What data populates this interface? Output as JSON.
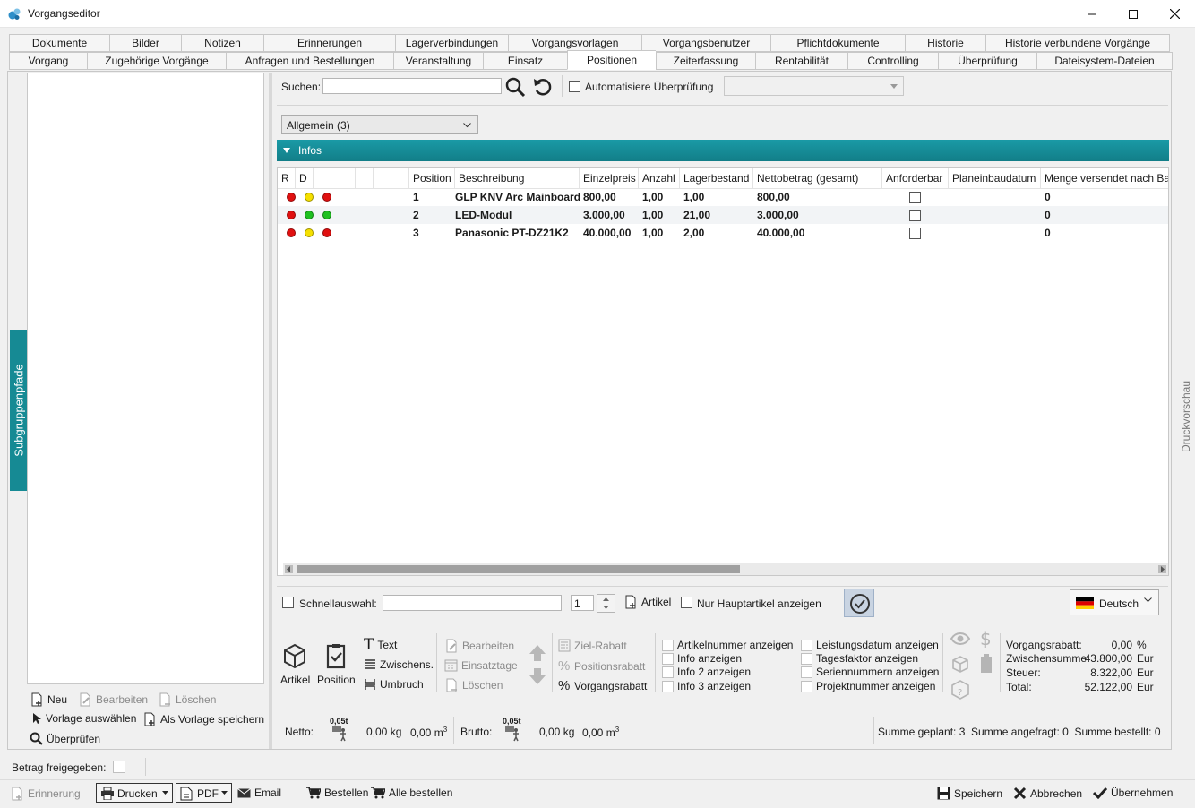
{
  "window": {
    "title": "Vorgangseditor"
  },
  "tabs_row1": [
    "Dokumente",
    "Bilder",
    "Notizen",
    "Erinnerungen",
    "Lagerverbindungen",
    "Vorgangsvorlagen",
    "Vorgangsbenutzer",
    "Pflichtdokumente",
    "Historie",
    "Historie verbundene Vorgänge"
  ],
  "tabs_row2": [
    "Vorgang",
    "Zugehörige Vorgänge",
    "Anfragen und Bestellungen",
    "Veranstaltung",
    "Einsatz",
    "Positionen",
    "Zeiterfassung",
    "Rentabilität",
    "Controlling",
    "Überprüfung",
    "Dateisystem-Dateien"
  ],
  "active_tab": "Positionen",
  "side": {
    "subgroup_label": "Subgruppenpfade",
    "preview_label": "Druckvorschau"
  },
  "left_actions": {
    "new": "Neu",
    "edit": "Bearbeiten",
    "delete": "Löschen",
    "choose_template": "Vorlage auswählen",
    "save_template": "Als Vorlage speichern",
    "check": "Überprüfen"
  },
  "search": {
    "label": "Suchen:",
    "value": "",
    "auto_check": "Automatisiere Überprüfung"
  },
  "group_select": "Allgemein (3)",
  "section_title": "Infos",
  "grid": {
    "headers": [
      "R",
      "D",
      "",
      "",
      "",
      "",
      "",
      "Position",
      "Beschreibung",
      "Einzelpreis",
      "Anzahl",
      "Lagerbestand",
      "Nettobetrag (gesamt)",
      "",
      "Anforderbar",
      "Planeinbaudatum",
      "Menge versendet nach Bau"
    ],
    "rows": [
      {
        "r": "#e01010",
        "d1": "#f5e000",
        "d2": "#e01010",
        "position": "1",
        "beschreibung": "GLP KNV Arc Mainboard",
        "einzelpreis": "800,00",
        "anzahl": "1,00",
        "lagerbestand": "1,00",
        "netto": "800,00",
        "menge": "0"
      },
      {
        "r": "#e01010",
        "d1": "#20c020",
        "d2": "#20c020",
        "position": "2",
        "beschreibung": "LED-Modul",
        "einzelpreis": "3.000,00",
        "anzahl": "1,00",
        "lagerbestand": "21,00",
        "netto": "3.000,00",
        "menge": "0"
      },
      {
        "r": "#e01010",
        "d1": "#f5e000",
        "d2": "#e01010",
        "position": "3",
        "beschreibung": "Panasonic PT-DZ21K2",
        "einzelpreis": "40.000,00",
        "anzahl": "1,00",
        "lagerbestand": "2,00",
        "netto": "40.000,00",
        "menge": "0"
      }
    ]
  },
  "quick": {
    "label": "Schnellauswahl:",
    "value": "",
    "qty": "1",
    "artikel": "Artikel",
    "main_only": "Nur Hauptartikel anzeigen",
    "language": "Deutsch"
  },
  "toolbar": {
    "artikel": "Artikel",
    "position": "Position",
    "text": "Text",
    "zwischen": "Zwischens.",
    "umbruch": "Umbruch",
    "bearbeiten": "Bearbeiten",
    "einsatztage": "Einsatztage",
    "loeschen": "Löschen",
    "ziel_rabatt": "Ziel-Rabatt",
    "positionsrabatt": "Positionsrabatt",
    "vorgangsrabatt": "Vorgangsrabatt",
    "opts_left": [
      "Artikelnummer anzeigen",
      "Info anzeigen",
      "Info 2 anzeigen",
      "Info 3 anzeigen"
    ],
    "opts_right": [
      "Leistungsdatum anzeigen",
      "Tagesfaktor anzeigen",
      "Seriennummern anzeigen",
      "Projektnummer anzeigen"
    ]
  },
  "totals": {
    "vorgangsrabatt_label": "Vorgangsrabatt:",
    "vorgangsrabatt_value": "0,00",
    "vorgangsrabatt_unit": "%",
    "zwischensumme_label": "Zwischensumme:",
    "zwischensumme_value": "43.800,00",
    "zwischensumme_unit": "Eur",
    "steuer_label": "Steuer:",
    "steuer_value": "8.322,00",
    "steuer_unit": "Eur",
    "total_label": "Total:",
    "total_value": "52.122,00",
    "total_unit": "Eur"
  },
  "weights": {
    "netto_label": "Netto:",
    "netto_badge": "0,05t",
    "netto_kg": "0,00 kg",
    "netto_m3": "0,00 m",
    "brutto_label": "Brutto:",
    "brutto_badge": "0,05t",
    "brutto_kg": "0,00 kg",
    "brutto_m3": "0,00 m",
    "summary": "Summe geplant: 3  Summe angefragt: 0  Summe bestellt: 0"
  },
  "bottom": {
    "freigabe_label": "Betrag freigegeben:",
    "erinnerung": "Erinnerung",
    "drucken": "Drucken",
    "pdf": "PDF",
    "email": "Email",
    "bestellen": "Bestellen",
    "alle_bestellen": "Alle bestellen",
    "speichern": "Speichern",
    "abbrechen": "Abbrechen",
    "uebernehmen": "Übernehmen"
  },
  "colors": {
    "accent": "#168a94"
  }
}
